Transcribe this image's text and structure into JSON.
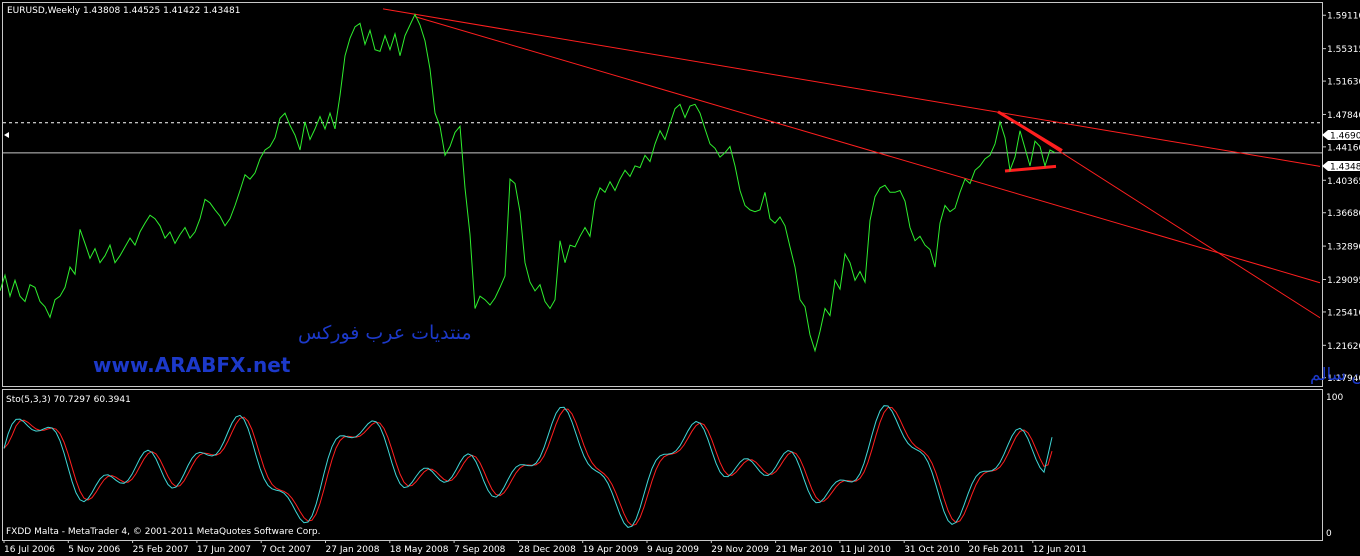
{
  "main_panel": {
    "header": "EURUSD,Weekly  1.43808 1.44525 1.41422 1.43481",
    "watermark_arabic": "منتديات عرب فوركس",
    "watermark_url": "www.ARABFX.net",
    "author": "د.عبد الرحمن سالم"
  },
  "sub_panel": {
    "header": "Sto(5,3,3) 70.7297 60.3941",
    "scale_top": "100",
    "scale_bottom": "0"
  },
  "footer": "FXDD Malta - MetaTrader 4, © 2001-2011 MetaQuotes Software Corp.",
  "colors": {
    "background": "#000000",
    "price_line": "#2eee2e",
    "trendlines": "#ff1f1f",
    "stoch_main": "#3fd6d6",
    "stoch_signal": "#ff1f1f",
    "grid": "#c8c8c8",
    "watermark": "#1c39c9"
  },
  "chart_data": [
    {
      "type": "line",
      "title": "EURUSD,Weekly",
      "ohlc_header": {
        "open": 1.43808,
        "high": 1.44525,
        "low": 1.41422,
        "close": 1.43481
      },
      "x_ticks": [
        "16 Jul 2006",
        "5 Nov 2006",
        "25 Feb 2007",
        "17 Jun 2007",
        "7 Oct 2007",
        "27 Jan 2008",
        "18 May 2008",
        "7 Sep 2008",
        "28 Dec 2008",
        "19 Apr 2009",
        "9 Aug 2009",
        "29 Nov 2009",
        "21 Mar 2010",
        "11 Jul 2010",
        "31 Oct 2010",
        "20 Feb 2011",
        "12 Jun 2011"
      ],
      "y_ticks": [
        "1.59110",
        "1.55315",
        "1.51630",
        "1.47840",
        "1.44160",
        "1.40365",
        "1.36680",
        "1.32890",
        "1.29095",
        "1.25410",
        "1.21620",
        "1.17940"
      ],
      "ylim": [
        1.17,
        1.605
      ],
      "price_labels": {
        "dashed_line": "1.46900",
        "current": "1.43481"
      },
      "dashed_line_value": 1.469,
      "current_value": 1.43481,
      "series": [
        {
          "values": [
            [
              0,
              1.278
            ],
            [
              5,
              1.296
            ],
            [
              10,
              1.272
            ],
            [
              15,
              1.29
            ],
            [
              20,
              1.272
            ],
            [
              25,
              1.266
            ],
            [
              30,
              1.285
            ],
            [
              35,
              1.282
            ],
            [
              40,
              1.266
            ],
            [
              45,
              1.26
            ],
            [
              50,
              1.248
            ],
            [
              55,
              1.268
            ],
            [
              60,
              1.272
            ],
            [
              65,
              1.282
            ],
            [
              70,
              1.305
            ],
            [
              75,
              1.297
            ],
            [
              80,
              1.348
            ],
            [
              85,
              1.332
            ],
            [
              90,
              1.315
            ],
            [
              95,
              1.326
            ],
            [
              100,
              1.31
            ],
            [
              105,
              1.318
            ],
            [
              110,
              1.33
            ],
            [
              115,
              1.31
            ],
            [
              120,
              1.318
            ],
            [
              125,
              1.328
            ],
            [
              130,
              1.338
            ],
            [
              135,
              1.33
            ],
            [
              140,
              1.345
            ],
            [
              145,
              1.355
            ],
            [
              150,
              1.364
            ],
            [
              155,
              1.36
            ],
            [
              160,
              1.352
            ],
            [
              165,
              1.338
            ],
            [
              170,
              1.345
            ],
            [
              175,
              1.332
            ],
            [
              180,
              1.342
            ],
            [
              185,
              1.35
            ],
            [
              190,
              1.338
            ],
            [
              195,
              1.345
            ],
            [
              200,
              1.36
            ],
            [
              205,
              1.382
            ],
            [
              210,
              1.378
            ],
            [
              215,
              1.37
            ],
            [
              220,
              1.363
            ],
            [
              225,
              1.352
            ],
            [
              230,
              1.36
            ],
            [
              235,
              1.375
            ],
            [
              240,
              1.392
            ],
            [
              245,
              1.41
            ],
            [
              250,
              1.405
            ],
            [
              255,
              1.412
            ],
            [
              260,
              1.428
            ],
            [
              265,
              1.438
            ],
            [
              270,
              1.442
            ],
            [
              275,
              1.452
            ],
            [
              280,
              1.474
            ],
            [
              285,
              1.48
            ],
            [
              290,
              1.466
            ],
            [
              295,
              1.455
            ],
            [
              300,
              1.438
            ],
            [
              305,
              1.47
            ],
            [
              310,
              1.45
            ],
            [
              315,
              1.462
            ],
            [
              320,
              1.476
            ],
            [
              325,
              1.462
            ],
            [
              330,
              1.48
            ],
            [
              335,
              1.462
            ],
            [
              340,
              1.5
            ],
            [
              345,
              1.545
            ],
            [
              350,
              1.565
            ],
            [
              355,
              1.578
            ],
            [
              360,
              1.582
            ],
            [
              365,
              1.558
            ],
            [
              370,
              1.574
            ],
            [
              375,
              1.552
            ],
            [
              380,
              1.55
            ],
            [
              385,
              1.568
            ],
            [
              390,
              1.552
            ],
            [
              395,
              1.57
            ],
            [
              400,
              1.545
            ],
            [
              405,
              1.568
            ],
            [
              410,
              1.58
            ],
            [
              415,
              1.592
            ],
            [
              420,
              1.58
            ],
            [
              425,
              1.562
            ],
            [
              430,
              1.53
            ],
            [
              435,
              1.48
            ],
            [
              440,
              1.465
            ],
            [
              445,
              1.432
            ],
            [
              450,
              1.442
            ],
            [
              455,
              1.458
            ],
            [
              460,
              1.465
            ],
            [
              465,
              1.395
            ],
            [
              470,
              1.342
            ],
            [
              475,
              1.258
            ],
            [
              480,
              1.272
            ],
            [
              485,
              1.268
            ],
            [
              490,
              1.262
            ],
            [
              495,
              1.27
            ],
            [
              500,
              1.282
            ],
            [
              505,
              1.295
            ],
            [
              510,
              1.405
            ],
            [
              515,
              1.4
            ],
            [
              520,
              1.368
            ],
            [
              525,
              1.31
            ],
            [
              530,
              1.288
            ],
            [
              535,
              1.278
            ],
            [
              540,
              1.285
            ],
            [
              545,
              1.266
            ],
            [
              550,
              1.258
            ],
            [
              555,
              1.268
            ],
            [
              560,
              1.335
            ],
            [
              565,
              1.31
            ],
            [
              570,
              1.33
            ],
            [
              575,
              1.328
            ],
            [
              580,
              1.34
            ],
            [
              585,
              1.35
            ],
            [
              590,
              1.34
            ],
            [
              595,
              1.38
            ],
            [
              600,
              1.395
            ],
            [
              605,
              1.39
            ],
            [
              610,
              1.402
            ],
            [
              615,
              1.392
            ],
            [
              620,
              1.405
            ],
            [
              625,
              1.415
            ],
            [
              630,
              1.408
            ],
            [
              635,
              1.42
            ],
            [
              640,
              1.418
            ],
            [
              645,
              1.432
            ],
            [
              650,
              1.425
            ],
            [
              655,
              1.445
            ],
            [
              660,
              1.46
            ],
            [
              665,
              1.45
            ],
            [
              670,
              1.468
            ],
            [
              675,
              1.485
            ],
            [
              680,
              1.49
            ],
            [
              685,
              1.475
            ],
            [
              690,
              1.488
            ],
            [
              695,
              1.49
            ],
            [
              700,
              1.48
            ],
            [
              705,
              1.462
            ],
            [
              710,
              1.445
            ],
            [
              715,
              1.44
            ],
            [
              720,
              1.43
            ],
            [
              725,
              1.435
            ],
            [
              730,
              1.442
            ],
            [
              735,
              1.42
            ],
            [
              740,
              1.392
            ],
            [
              745,
              1.375
            ],
            [
              750,
              1.37
            ],
            [
              755,
              1.368
            ],
            [
              760,
              1.37
            ],
            [
              765,
              1.39
            ],
            [
              770,
              1.36
            ],
            [
              775,
              1.355
            ],
            [
              780,
              1.362
            ],
            [
              785,
              1.352
            ],
            [
              790,
              1.328
            ],
            [
              795,
              1.305
            ],
            [
              800,
              1.268
            ],
            [
              805,
              1.26
            ],
            [
              810,
              1.228
            ],
            [
              815,
              1.21
            ],
            [
              820,
              1.232
            ],
            [
              825,
              1.258
            ],
            [
              830,
              1.25
            ],
            [
              835,
              1.29
            ],
            [
              840,
              1.28
            ],
            [
              845,
              1.32
            ],
            [
              850,
              1.31
            ],
            [
              855,
              1.29
            ],
            [
              860,
              1.3
            ],
            [
              865,
              1.288
            ],
            [
              870,
              1.358
            ],
            [
              875,
              1.385
            ],
            [
              880,
              1.395
            ],
            [
              885,
              1.398
            ],
            [
              890,
              1.39
            ],
            [
              895,
              1.39
            ],
            [
              900,
              1.392
            ],
            [
              905,
              1.38
            ],
            [
              910,
              1.35
            ],
            [
              915,
              1.335
            ],
            [
              920,
              1.34
            ],
            [
              925,
              1.33
            ],
            [
              930,
              1.325
            ],
            [
              935,
              1.305
            ],
            [
              940,
              1.355
            ],
            [
              945,
              1.375
            ],
            [
              950,
              1.368
            ],
            [
              955,
              1.372
            ],
            [
              960,
              1.39
            ],
            [
              965,
              1.405
            ],
            [
              970,
              1.4
            ],
            [
              975,
              1.415
            ],
            [
              980,
              1.42
            ],
            [
              985,
              1.428
            ],
            [
              990,
              1.432
            ],
            [
              995,
              1.445
            ],
            [
              1000,
              1.47
            ],
            [
              1005,
              1.452
            ],
            [
              1010,
              1.415
            ],
            [
              1015,
              1.43
            ],
            [
              1020,
              1.46
            ],
            [
              1025,
              1.44
            ],
            [
              1030,
              1.42
            ],
            [
              1035,
              1.448
            ],
            [
              1040,
              1.442
            ],
            [
              1045,
              1.42
            ],
            [
              1050,
              1.438
            ],
            [
              1055,
              1.435
            ]
          ]
        }
      ],
      "trendlines": [
        {
          "from": [
            383,
            1.5983
          ],
          "to": [
            1320,
            1.4195
          ]
        },
        {
          "from": [
            415,
            1.5895
          ],
          "to": [
            1320,
            1.2873
          ]
        },
        {
          "from": [
            998,
            1.4812
          ],
          "to": [
            1320,
            1.2475
          ]
        },
        {
          "from": [
            998,
            1.4815
          ],
          "to": [
            1062,
            1.4375
          ],
          "bold": true
        },
        {
          "from": [
            1005,
            1.4142
          ],
          "to": [
            1056,
            1.4195
          ],
          "bold": true
        }
      ]
    },
    {
      "type": "line",
      "title": "Sto(5,3,3)",
      "ylim": [
        0,
        100
      ],
      "series": [
        {
          "name": "main",
          "last": 70.7297
        },
        {
          "name": "signal",
          "last": 60.3941
        }
      ]
    }
  ]
}
